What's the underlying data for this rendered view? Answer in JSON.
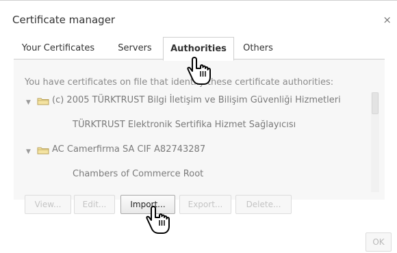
{
  "dialog": {
    "title": "Certificate manager",
    "close_label": "×"
  },
  "tabs": [
    {
      "label": "Your Certificates"
    },
    {
      "label": "Servers"
    },
    {
      "label": "Authorities",
      "active": true
    },
    {
      "label": "Others"
    }
  ],
  "panel": {
    "intro": "You have certificates on file that identify these certificate authorities:",
    "tree": [
      {
        "kind": "folder",
        "expanded": true,
        "label": "(c) 2005 TÜRKTRUST Bilgi İletişim ve Bilişim Güvenliği Hizmetleri"
      },
      {
        "kind": "item",
        "label": "TÜRKTRUST Elektronik Sertifika Hizmet Sağlayıcısı"
      },
      {
        "kind": "folder",
        "expanded": true,
        "label": "AC Camerfirma SA CIF A82743287"
      },
      {
        "kind": "item",
        "label": "Chambers of Commerce Root"
      }
    ]
  },
  "buttons": {
    "view": "View...",
    "edit": "Edit...",
    "import": "Import...",
    "export": "Export...",
    "delete": "Delete...",
    "ok": "OK"
  },
  "icons": {
    "expand_arrow": "triangle-down",
    "folder": "folder-icon",
    "cursor": "hand-pointer-cursor"
  },
  "colors": {
    "folder_fill": "#f4e3a1",
    "folder_stroke": "#b9a25a"
  }
}
